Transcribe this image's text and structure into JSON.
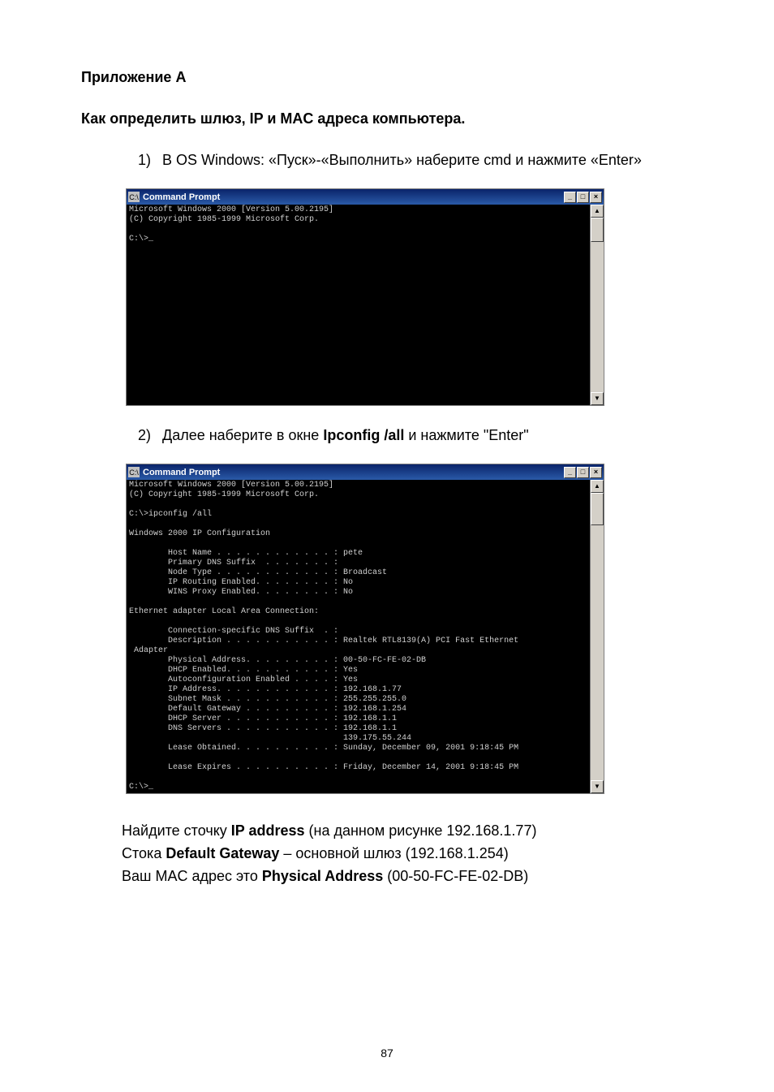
{
  "doc": {
    "title": "Приложение А",
    "subtitle": "Как определить шлюз, IP и MAC адреса компьютера.",
    "step1_num": "1)",
    "step1_text": "В OS Windows: «Пуск»-«Выполнить» наберите cmd и нажмите «Enter»",
    "step2_num": "2)",
    "step2_prefix": "Далее наберите в окне ",
    "step2_bold": "Ipconfig /all",
    "step2_suffix": " и нажмите \"Enter\"",
    "footer_l1a": "Найдите сточку ",
    "footer_l1b": "IP address",
    "footer_l1c": " (на данном рисунке 192.168.1.77)",
    "footer_l2a": "Стока ",
    "footer_l2b": "Default Gateway",
    "footer_l2c": " – основной шлюз (192.168.1.254)",
    "footer_l3a": "Ваш MAC адрес это ",
    "footer_l3b": "Physical Address",
    "footer_l3c": " (00-50-FC-FE-02-DB)",
    "page_number": "87"
  },
  "cmd1": {
    "title": "Command Prompt",
    "body": "Microsoft Windows 2000 [Version 5.00.2195]\n(C) Copyright 1985-1999 Microsoft Corp.\n\nC:\\>_\n\n\n\n\n\n\n\n\n\n\n\n\n\n\n\n"
  },
  "cmd2": {
    "title": "Command Prompt",
    "body": "Microsoft Windows 2000 [Version 5.00.2195]\n(C) Copyright 1985-1999 Microsoft Corp.\n\nC:\\>ipconfig /all\n\nWindows 2000 IP Configuration\n\n        Host Name . . . . . . . . . . . . : pete\n        Primary DNS Suffix  . . . . . . . :\n        Node Type . . . . . . . . . . . . : Broadcast\n        IP Routing Enabled. . . . . . . . : No\n        WINS Proxy Enabled. . . . . . . . : No\n\nEthernet adapter Local Area Connection:\n\n        Connection-specific DNS Suffix  . :\n        Description . . . . . . . . . . . : Realtek RTL8139(A) PCI Fast Ethernet\n Adapter\n        Physical Address. . . . . . . . . : 00-50-FC-FE-02-DB\n        DHCP Enabled. . . . . . . . . . . : Yes\n        Autoconfiguration Enabled . . . . : Yes\n        IP Address. . . . . . . . . . . . : 192.168.1.77\n        Subnet Mask . . . . . . . . . . . : 255.255.255.0\n        Default Gateway . . . . . . . . . : 192.168.1.254\n        DHCP Server . . . . . . . . . . . : 192.168.1.1\n        DNS Servers . . . . . . . . . . . : 192.168.1.1\n                                            139.175.55.244\n        Lease Obtained. . . . . . . . . . : Sunday, December 09, 2001 9:18:45 PM\n\n        Lease Expires . . . . . . . . . . : Friday, December 14, 2001 9:18:45 PM\n\nC:\\>_"
  },
  "winctl": {
    "min": "_",
    "max": "□",
    "close": "×",
    "up": "▲",
    "down": "▼"
  }
}
